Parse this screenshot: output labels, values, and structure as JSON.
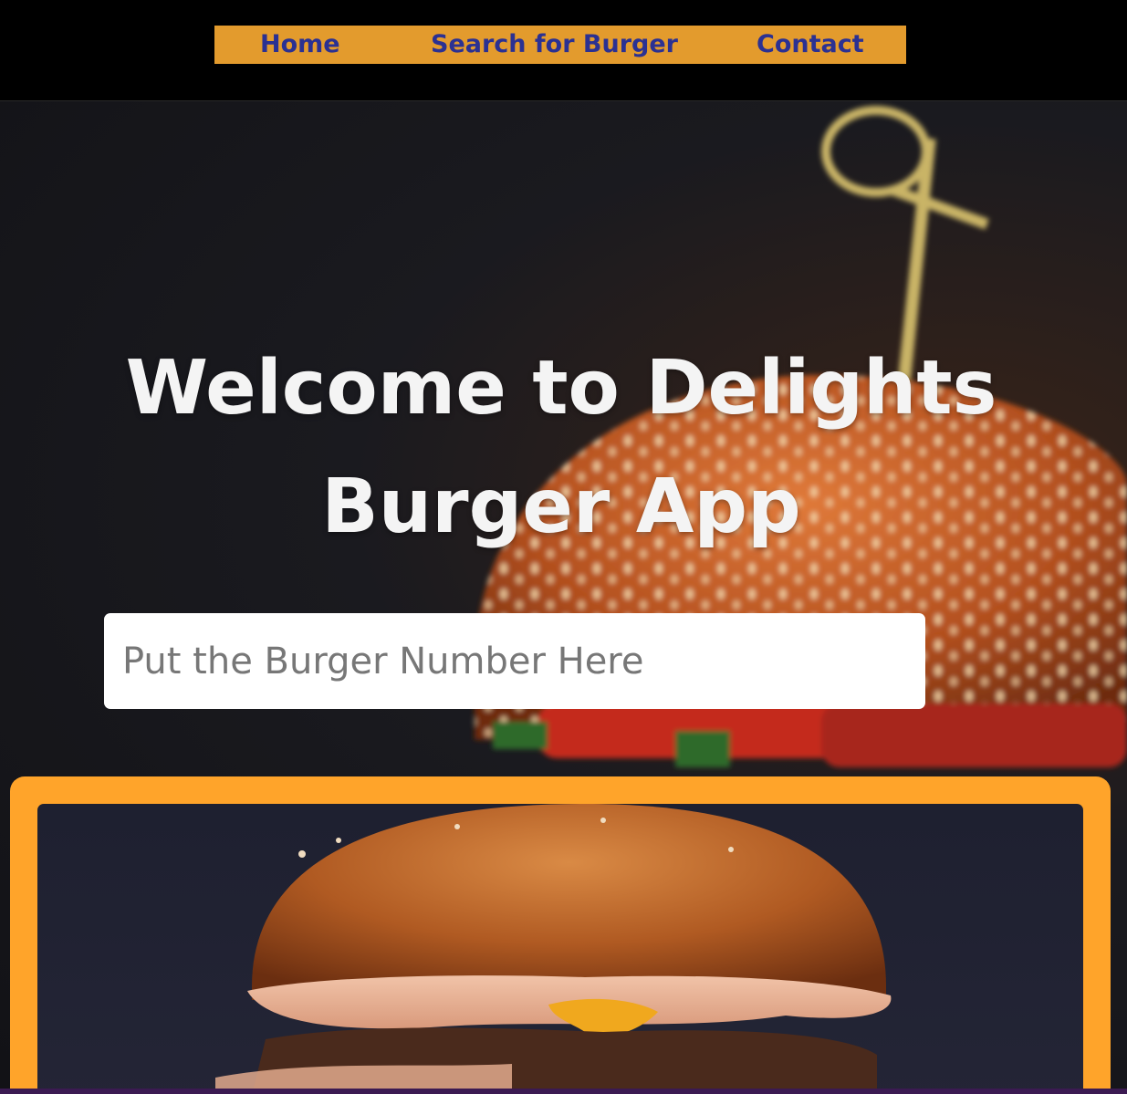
{
  "nav": {
    "home": "Home",
    "search": "Search for Burger",
    "contact": "Contact"
  },
  "hero": {
    "title": "Welcome to Delights Burger App",
    "search_placeholder": "Put the Burger Number Here"
  },
  "colors": {
    "nav_bg": "#e39b2d",
    "nav_text": "#2b3192",
    "card_border": "#ffa42a",
    "hero_text": "#f4f4f4"
  }
}
